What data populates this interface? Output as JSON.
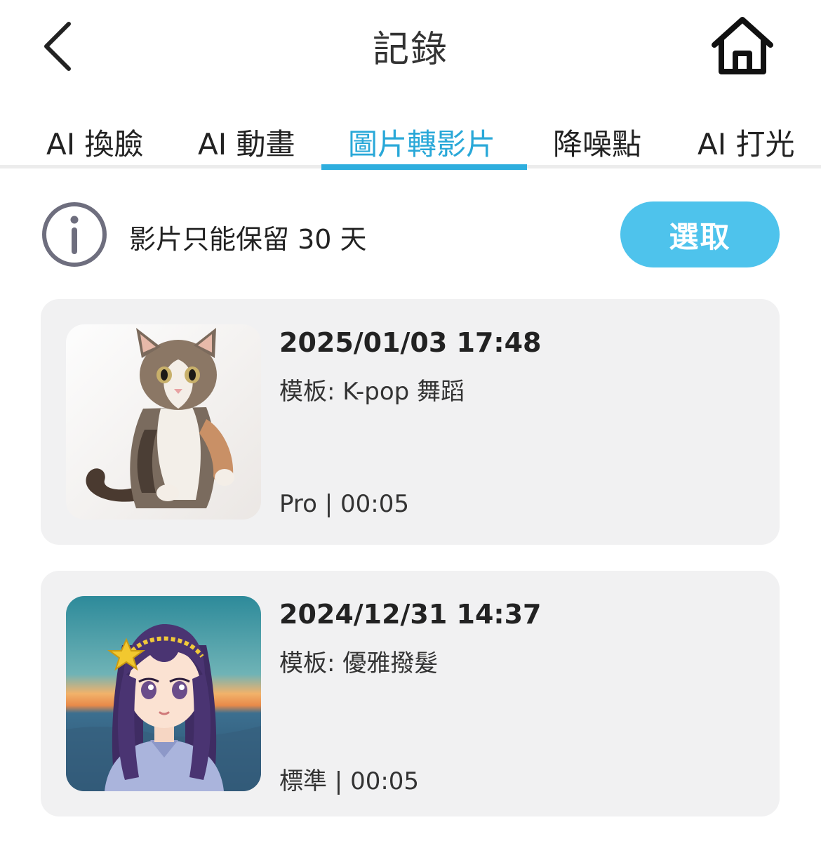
{
  "header": {
    "title": "記錄",
    "back_icon": "chevron-left-icon",
    "home_icon": "home-icon"
  },
  "tabs": [
    {
      "label": "AI 換臉",
      "active": false
    },
    {
      "label": "AI 動畫",
      "active": false
    },
    {
      "label": "圖片轉影片",
      "active": true
    },
    {
      "label": "降噪點",
      "active": false
    },
    {
      "label": "AI 打光",
      "active": false
    }
  ],
  "notice": {
    "icon": "info-icon",
    "text": "影片只能保留 30 天",
    "select_label": "選取"
  },
  "records": [
    {
      "datetime": "2025/01/03 17:48",
      "template": "模板: K-pop 舞蹈",
      "meta": "Pro | 00:05",
      "thumbnail": "cat-standing-photo"
    },
    {
      "datetime": "2024/12/31 14:37",
      "template": "模板: 優雅撥髮",
      "meta": "標準 | 00:05",
      "thumbnail": "anime-girl-portrait"
    }
  ],
  "colors": {
    "accent": "#2eaede",
    "button": "#4ec3ec",
    "card_bg": "#f1f1f2",
    "text": "#222222"
  }
}
